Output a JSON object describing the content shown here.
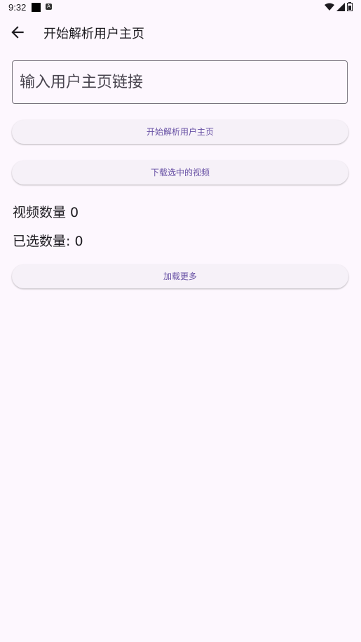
{
  "status_bar": {
    "time": "9:32",
    "icons": [
      "notification-square-icon",
      "a-badge-icon",
      "wifi-icon",
      "signal-icon",
      "battery-icon"
    ]
  },
  "app_bar": {
    "back_icon": "arrow-back-icon",
    "title": "开始解析用户主页"
  },
  "url_input": {
    "placeholder": "输入用户主页链接",
    "value": ""
  },
  "buttons": {
    "parse": "开始解析用户主页",
    "download_selected": "下载选中的视频",
    "load_more": "加载更多"
  },
  "stats": {
    "video_count": "视频数量 0",
    "selected_count": "已选数量: 0"
  },
  "colors": {
    "background": "#fdf7fe",
    "accent": "#6750a4",
    "button_bg": "#f6f1f8"
  }
}
